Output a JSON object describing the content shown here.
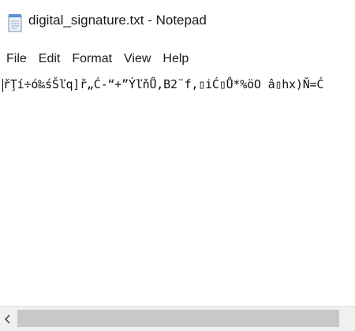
{
  "window": {
    "title": "digital_signature.txt - Notepad",
    "icon": "notepad-icon"
  },
  "menu": {
    "items": [
      "File",
      "Edit",
      "Format",
      "View",
      "Help"
    ]
  },
  "editor": {
    "content": "řŢí÷ó‰śŠľq]ř„Ć-“+”ÝľňŮ,B2¨f,▯iĆ▯Ů*%öO â▯hx)Ň=Ć"
  },
  "scrollbar": {
    "left_arrow_icon": "chevron-left-icon"
  }
}
